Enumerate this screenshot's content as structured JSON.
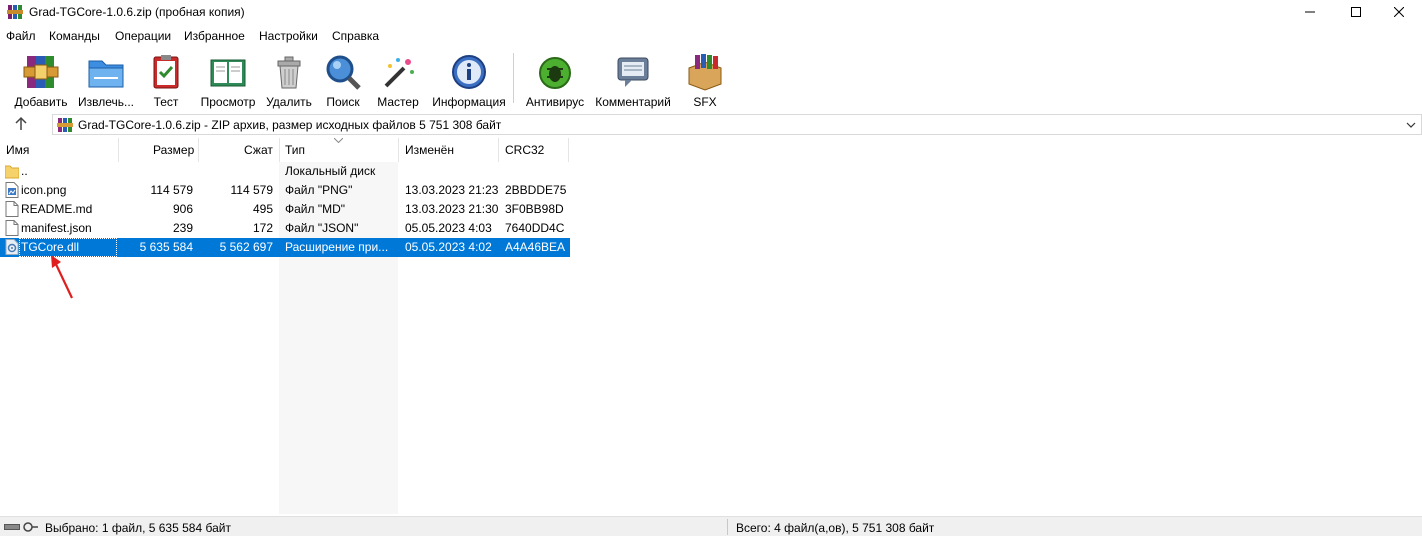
{
  "window": {
    "title": "Grad-TGCore-1.0.6.zip (пробная копия)"
  },
  "menu": [
    "Файл",
    "Команды",
    "Операции",
    "Избранное",
    "Настройки",
    "Справка"
  ],
  "toolbar": {
    "buttons": [
      {
        "label": "Добавить",
        "icon": "add-archive-icon"
      },
      {
        "label": "Извлечь...",
        "icon": "extract-folder-icon"
      },
      {
        "label": "Тест",
        "icon": "test-clipboard-icon"
      },
      {
        "label": "Просмотр",
        "icon": "view-book-icon"
      },
      {
        "label": "Удалить",
        "icon": "trash-icon"
      },
      {
        "label": "Поиск",
        "icon": "search-magnifier-icon"
      },
      {
        "label": "Мастер",
        "icon": "wizard-wand-icon"
      },
      {
        "label": "Информация",
        "icon": "info-icon"
      },
      {
        "label": "Антивирус",
        "icon": "antivirus-bug-icon"
      },
      {
        "label": "Комментарий",
        "icon": "comment-icon"
      },
      {
        "label": "SFX",
        "icon": "sfx-box-icon"
      }
    ]
  },
  "address": {
    "text": "Grad-TGCore-1.0.6.zip - ZIP архив, размер исходных файлов 5 751 308 байт"
  },
  "columns": [
    "Имя",
    "Размер",
    "Сжат",
    "Тип",
    "Изменён",
    "CRC32"
  ],
  "files": [
    {
      "name": "..",
      "size": "",
      "packed": "",
      "type": "Локальный диск",
      "modified": "",
      "crc": "",
      "icon": "folder-icon",
      "selected": false
    },
    {
      "name": "icon.png",
      "size": "114 579",
      "packed": "114 579",
      "type": "Файл \"PNG\"",
      "modified": "13.03.2023 21:23",
      "crc": "2BBDDE75",
      "icon": "image-file-icon",
      "selected": false
    },
    {
      "name": "README.md",
      "size": "906",
      "packed": "495",
      "type": "Файл \"MD\"",
      "modified": "13.03.2023 21:30",
      "crc": "3F0BB98D",
      "icon": "file-icon",
      "selected": false
    },
    {
      "name": "manifest.json",
      "size": "239",
      "packed": "172",
      "type": "Файл \"JSON\"",
      "modified": "05.05.2023 4:03",
      "crc": "7640DD4C",
      "icon": "file-icon",
      "selected": false
    },
    {
      "name": "TGCore.dll",
      "size": "5 635 584",
      "packed": "5 562 697",
      "type": "Расширение при...",
      "modified": "05.05.2023 4:02",
      "crc": "A4A46BEA",
      "icon": "dll-gear-icon",
      "selected": true
    }
  ],
  "status": {
    "left": "Выбрано: 1 файл, 5 635 584 байт",
    "right": "Всего: 4 файл(а,ов), 5 751 308 байт"
  },
  "colors": {
    "selection": "#0078d7",
    "annotation_arrow": "#e01e1e"
  }
}
